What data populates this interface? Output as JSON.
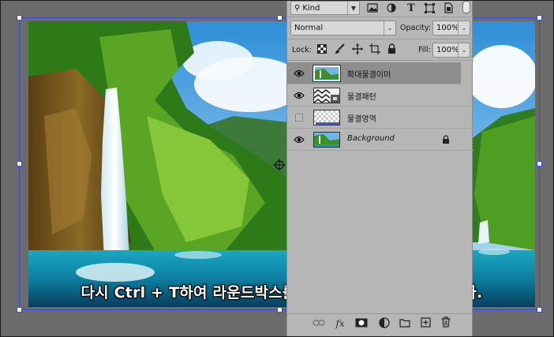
{
  "caption": "다시 Ctrl + T하여 라운드박스를 보면 커져있음을 알 수 있다.",
  "colors": {
    "workspace": "#6b6b6b",
    "panel": "#b6b6b6",
    "selected_layer": "#8e8e8e",
    "bbox": "#3a4ad8"
  },
  "filter": {
    "label": "Kind",
    "icons": [
      "image-filter-icon",
      "adjustment-filter-icon",
      "type-filter-icon",
      "shape-filter-icon",
      "smart-object-filter-icon"
    ]
  },
  "blend": {
    "mode": "Normal",
    "opacity_label": "Opacity:",
    "opacity_value": "100%"
  },
  "lock": {
    "label": "Lock:",
    "icons": [
      "lock-transparent-icon",
      "lock-image-icon",
      "lock-position-icon",
      "lock-artboard-icon",
      "lock-all-icon"
    ],
    "fill_label": "Fill:",
    "fill_value": "100%"
  },
  "layers": [
    {
      "name": "확대물결이미",
      "visible": true,
      "selected": true,
      "thumb": "landscape",
      "italic": false,
      "locked": false
    },
    {
      "name": "물결패턴",
      "visible": true,
      "selected": false,
      "thumb": "pattern",
      "italic": false,
      "locked": false
    },
    {
      "name": "물결영역",
      "visible": false,
      "selected": false,
      "thumb": "transparent",
      "italic": false,
      "locked": false
    },
    {
      "name": "Background",
      "visible": true,
      "selected": false,
      "thumb": "landscape",
      "italic": true,
      "locked": true
    }
  ],
  "bottom_icons": [
    "link-layers-icon",
    "fx-icon",
    "add-mask-icon",
    "adjustment-layer-icon",
    "new-group-icon",
    "new-layer-icon",
    "delete-layer-icon"
  ],
  "fx_label": "fx"
}
